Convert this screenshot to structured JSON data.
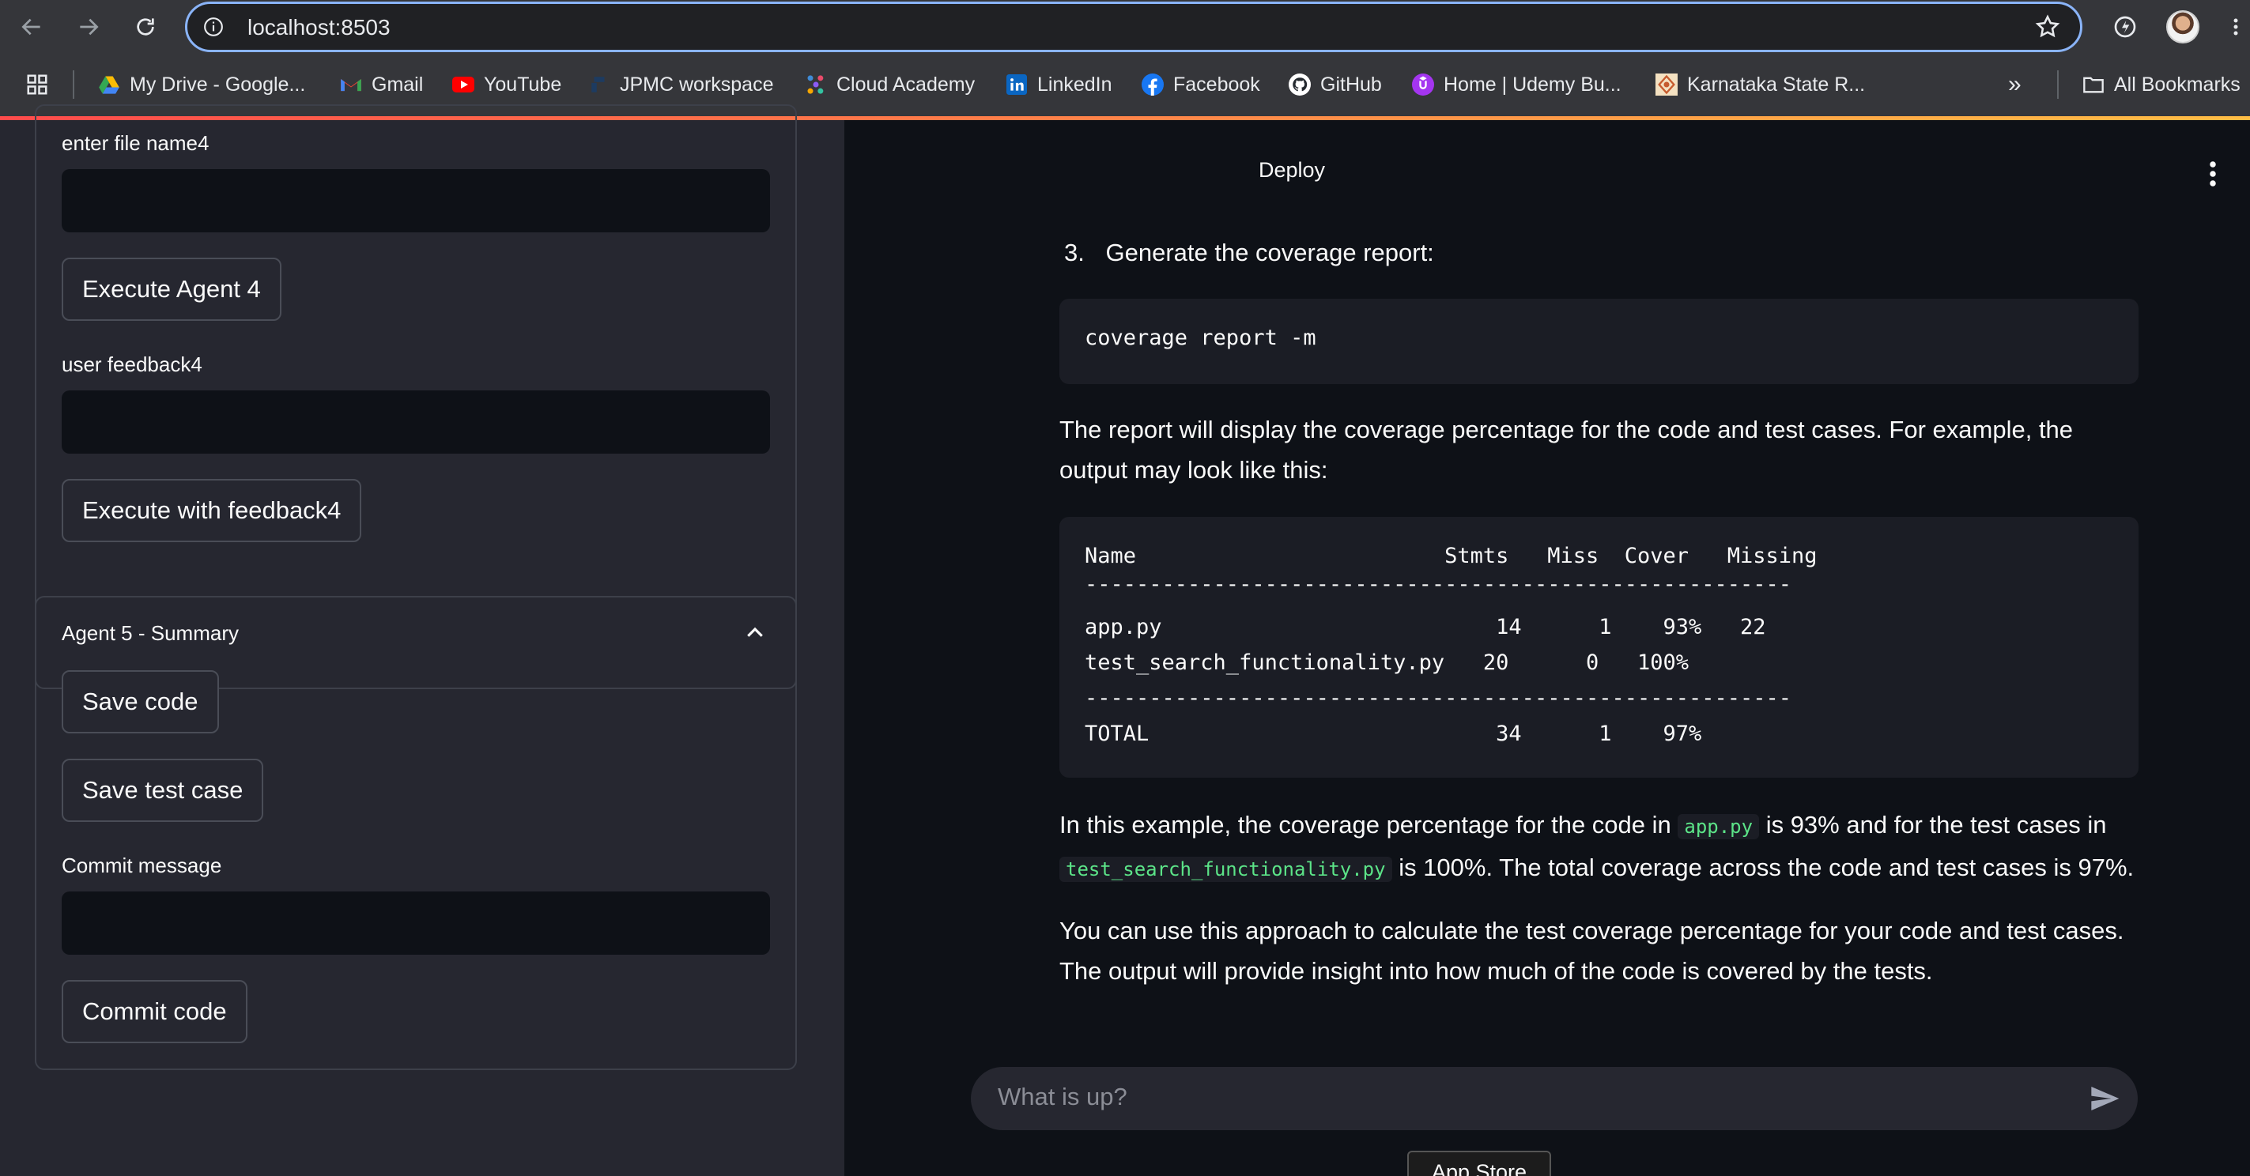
{
  "browser": {
    "url": "localhost:8503",
    "bookmarks": [
      {
        "label": "My Drive - Google...",
        "icon": "google-drive-icon"
      },
      {
        "label": "Gmail",
        "icon": "gmail-icon"
      },
      {
        "label": "YouTube",
        "icon": "youtube-icon"
      },
      {
        "label": "JPMC workspace",
        "icon": "jpmc-icon"
      },
      {
        "label": "Cloud Academy",
        "icon": "cloud-academy-icon"
      },
      {
        "label": "LinkedIn",
        "icon": "linkedin-icon"
      },
      {
        "label": "Facebook",
        "icon": "facebook-icon"
      },
      {
        "label": "GitHub",
        "icon": "github-icon"
      },
      {
        "label": "Home | Udemy Bu...",
        "icon": "udemy-icon"
      },
      {
        "label": "Karnataka State R...",
        "icon": "karnataka-icon"
      }
    ],
    "all_bookmarks": "All Bookmarks",
    "overflow": "»"
  },
  "sidebar": {
    "file_name_label": "enter file name4",
    "execute_agent_button": "Execute Agent 4",
    "feedback_label": "user feedback4",
    "execute_feedback_button": "Execute with feedback4",
    "agent5_title": "Agent 5 - Summary",
    "save_code_button": "Save code",
    "save_test_button": "Save test case",
    "commit_label": "Commit message",
    "commit_button": "Commit code"
  },
  "header": {
    "deploy": "Deploy"
  },
  "main": {
    "step_number": "3.",
    "step_text": "Generate the coverage report:",
    "command": "coverage report -m",
    "report_intro": "The report will display the coverage percentage for the code and test cases. For example, the output may look like this:",
    "report_lines": [
      "Name                        Stmts   Miss  Cover   Missing",
      "-------------------------------------------------------",
      "app.py                          14      1    93%   22",
      "test_search_functionality.py   20      0   100%",
      "-------------------------------------------------------",
      "TOTAL                           34      1    97%"
    ],
    "example_pre": "In this example, the coverage percentage for the code in ",
    "example_code1": "app.py",
    "example_mid": " is 93% and for the test cases in ",
    "example_code2": "test_search_functionality.py",
    "example_post": " is 100%. The total coverage across the code and test cases is 97%.",
    "closing": "You can use this approach to calculate the test coverage percentage for your code and test cases. The output will provide insight into how much of the code is covered by the tests."
  },
  "chat": {
    "placeholder": "What is up?"
  },
  "footer": {
    "app_store": "App Store"
  },
  "colors": {
    "accent": "#ff4b4b",
    "code_green": "#5ce488",
    "background": "#0e1117",
    "sidebar": "#262730"
  }
}
